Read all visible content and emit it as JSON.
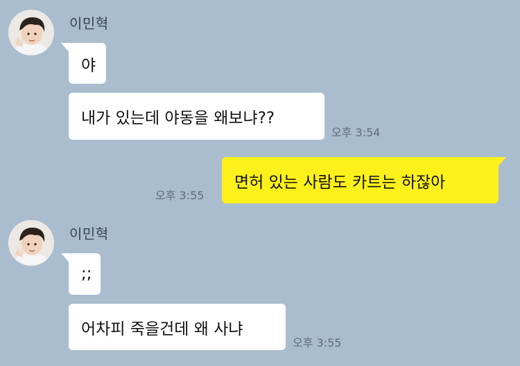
{
  "chat": {
    "group1": {
      "sender": "이민혁",
      "messages": [
        "야",
        "내가 있는데 야동을 왜보냐??"
      ],
      "time": "오후 3:54"
    },
    "my_message": {
      "text": "면허 있는 사람도 카트는 하잖아",
      "time": "오후 3:55"
    },
    "group2": {
      "sender": "이민혁",
      "messages": [
        ";;",
        "어차피 죽을건데 왜 사냐"
      ],
      "time": "오후 3:55"
    }
  },
  "colors": {
    "background": "#a9bdce",
    "incoming_bubble": "#ffffff",
    "outgoing_bubble": "#fef01b"
  },
  "icons": {
    "avatar": "profile-photo-icon"
  }
}
